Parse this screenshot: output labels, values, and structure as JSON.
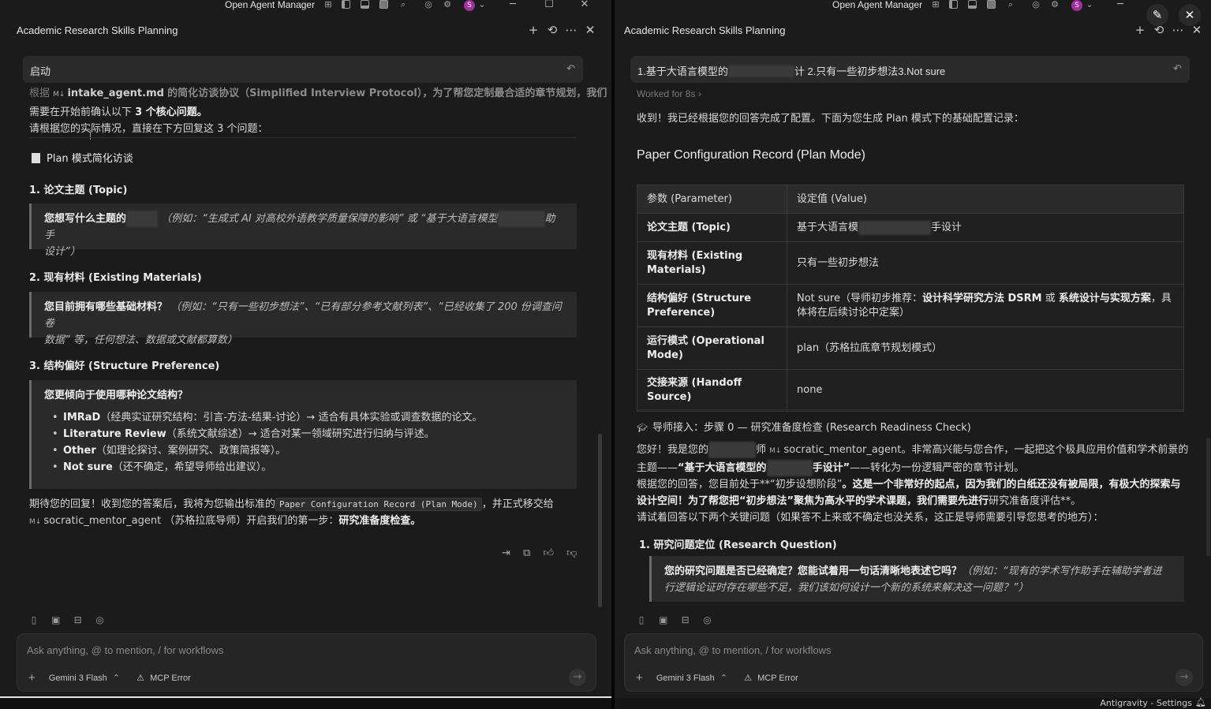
{
  "app": {
    "window_title": "Open Agent Manager",
    "panel_title": "Academic Research Skills Planning",
    "status_right": "Antigravity - Settings"
  },
  "left": {
    "user_msg": "启动",
    "intro_prefix": "根据",
    "intro_file": "intake_agent.md",
    "intro_mid": "的简化访谈协议（Simplified Interview Protocol），为了帮您定制最合适的章节规划，我们",
    "intro_line2_a": "需要在开始前确认以下",
    "intro_line2_b": "3 个核心问题。",
    "intro_line3": "请根据您的实际情况，直接在下方回复这 3 个问题：",
    "section_title": "Plan 模式简化访谈",
    "q1_title": "1. 论文主题 (Topic)",
    "q1_bold": "您想写什么主题的",
    "q1_italic_a": "（例如：“生成式 AI 对高校外语教学质量保障的影响” 或 “基于大语言模型",
    "q1_italic_b": "助手",
    "q1_italic_c": "设计”）",
    "q2_title": "2. 现有材料 (Existing Materials)",
    "q2_bold": "您目前拥有哪些基础材料？",
    "q2_italic_a": "（例如：“只有一些初步想法”、“已有部分参考文献列表”、“已经收集了 200 份调查问卷",
    "q2_italic_b": "数据” 等，任何想法、数据或文献都算数）",
    "q3_title": "3. 结构偏好 (Structure Preference)",
    "q3_bold": "您更倾向于使用哪种论文结构？",
    "q3_items": [
      {
        "name": "IMRaD",
        "desc": "（经典实证研究结构：引言-方法-结果-讨论）→ 适合有具体实验或调查数据的论文。"
      },
      {
        "name": "Literature Review",
        "desc": "（系统文献综述）→ 适合对某一领域研究进行归纳与评述。"
      },
      {
        "name": "Other",
        "desc": "（如理论探讨、案例研究、政策简报等）。"
      },
      {
        "name": "Not sure",
        "desc": "（还不确定，希望导师给出建议）。"
      }
    ],
    "outro_a": "期待您的回复！收到您的答案后，我将为您输出标准的",
    "outro_code": "Paper Configuration Record (Plan Mode)",
    "outro_b": "，并正式移交给",
    "outro_agent": "socratic_mentor_agent",
    "outro_c": "（苏格拉底导师）开启我们的第一步：",
    "outro_d": "研究准备度检查。"
  },
  "right": {
    "user_msg_a": "1.基于大语言模型的",
    "user_msg_b": "计 2.只有一些初步想法3.Not sure",
    "worked": "Worked for 8s",
    "ack": "收到！我已经根据您的回答完成了配置。下面为您生成 Plan 模式下的基础配置记录：",
    "record_title": "Paper Configuration Record (Plan Mode)",
    "table_head": [
      "参数 (Parameter)",
      "设定值 (Value)"
    ],
    "table_rows": [
      {
        "k": "论文主题 (Topic)",
        "v_a": "基于大语言模",
        "v_b": "手设计"
      },
      {
        "k": "现有材料 (Existing Materials)",
        "v": "只有一些初步想法"
      },
      {
        "k": "结构偏好 (Structure Preference)",
        "v_a": "Not sure（导师初步推荐：",
        "v_b": "设计科学研究方法 DSRM",
        "v_c": " 或 ",
        "v_d": "系统设计与实现方案",
        "v_e": "，具体将在后续讨论中定案）"
      },
      {
        "k": "运行模式 (Operational Mode)",
        "v": "plan（苏格拉底章节规划模式）"
      },
      {
        "k": "交接来源 (Handoff Source)",
        "v": "none"
      }
    ],
    "mentor_title": "导师接入：步骤 0 — 研究准备度检查 (Research Readiness Check)",
    "greet_a": "您好！我是您的",
    "greet_b": "师",
    "greet_agent": "socratic_mentor_agent",
    "greet_c": "。非常高兴能与您合作，一起把这个极具应用价值和学术前景的",
    "greet_line2_a": "主题——",
    "greet_line2_b": "“基于大语言模型的",
    "greet_line2_c": "手设计”",
    "greet_line2_d": "——转化为一份逻辑严密的章节计划。",
    "stage_a": "根据您的回答，您目前处于**“初步设想阶段”",
    "stage_b": "。这是一个非常好的起点，因为我们的白纸还没有被局限，有极大的探索与",
    "stage_line2": "设计空间！为了帮您把“初步想法”聚焦为高水平的学术课题，我们需要先进行",
    "stage_line2_b": "研究准备度评估**。",
    "ask": "请试着回答以下两个关键问题（如果答不上来或不确定也没关系，这正是导师需要引导您思考的地方）：",
    "rq_title": "1. 研究问题定位 (Research Question)",
    "rq_bold": "您的研究问题是否已经确定？您能试着用一句话清晰地表述它吗？",
    "rq_italic_a": "（例如：“现有的学术写作助手在辅助学者进",
    "rq_italic_b": "行逻辑论证时存在哪些不足，我们该如何设计一个新的系统来解决这一问题？”）"
  },
  "input": {
    "placeholder": "Ask anything, @ to mention, / for workflows",
    "model": "Gemini 3 Flash",
    "mcp": "MCP Error"
  },
  "icons": {
    "avatar_letter": "S"
  }
}
